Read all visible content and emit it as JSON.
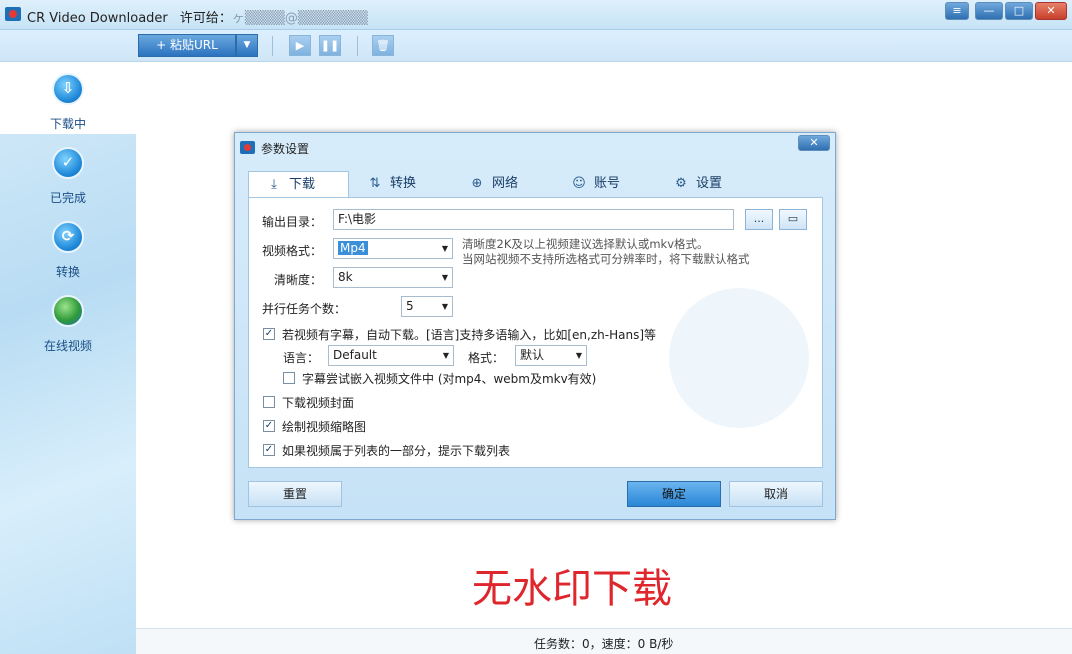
{
  "window": {
    "app_name": "CR Video Downloader",
    "license_label": "许可给：",
    "license_value": "ヶ▒▒▒▒@▒▒▒▒▒▒▒"
  },
  "toolbar": {
    "paste_url_label": "+ 粘贴URL",
    "dropdown_glyph": "▼",
    "start_glyph": "▶",
    "pause_glyph": "❚❚",
    "delete_glyph": "🗑"
  },
  "sidebar": {
    "items": [
      {
        "label": "下载中",
        "icon": "download-icon",
        "glyph": "⇩"
      },
      {
        "label": "已完成",
        "icon": "check-icon",
        "glyph": "✓"
      },
      {
        "label": "转换",
        "icon": "convert-icon",
        "glyph": "⟳"
      },
      {
        "label": "在线视频",
        "icon": "globe-icon",
        "glyph": ""
      }
    ]
  },
  "dialog": {
    "title": "参数设置",
    "close_glyph": "✕",
    "tabs": [
      {
        "label": "下载",
        "icon": "download-icon",
        "glyph": "⤓"
      },
      {
        "label": "转换",
        "icon": "convert-icon",
        "glyph": "⇅"
      },
      {
        "label": "网络",
        "icon": "globe-icon",
        "glyph": "⊕"
      },
      {
        "label": "账号",
        "icon": "user-icon",
        "glyph": "☺"
      },
      {
        "label": "设置",
        "icon": "gear-icon",
        "glyph": "⚙"
      }
    ],
    "output_dir": {
      "label": "输出目录：",
      "value": "F:\\电影",
      "browse_label": "...",
      "folder_glyph": "▭"
    },
    "video_format": {
      "label": "视频格式：",
      "value": "Mp4"
    },
    "format_hint": {
      "line1": "清晰度2K及以上视频建议选择默认或mkv格式。",
      "line2": "当网站视频不支持所选格式可分辨率时，将下载默认格式"
    },
    "resolution": {
      "label": "清晰度：",
      "value": "8k"
    },
    "concurrency": {
      "label": "并行任务个数：",
      "value": "5"
    },
    "subtitle_download": {
      "checked": true,
      "label": "若视频有字幕，自动下载。[语言]支持多语输入，比如[en,zh-Hans]等"
    },
    "language": {
      "label": "语言：",
      "value": "Default"
    },
    "subtitle_format": {
      "label": "格式：",
      "value": "默认"
    },
    "embed_subtitle": {
      "checked": false,
      "label": "字幕尝试嵌入视频文件中 (对mp4、webm及mkv有效)"
    },
    "download_cover": {
      "checked": false,
      "label": "下载视频封面"
    },
    "draw_thumbnail": {
      "checked": true,
      "label": "绘制视频缩略图"
    },
    "playlist_prompt": {
      "checked": true,
      "label": "如果视频属于列表的一部分，提示下载列表"
    },
    "reset_label": "重置",
    "ok_label": "确定",
    "cancel_label": "取消",
    "check_glyph": "✓",
    "arrow_glyph": "▼"
  },
  "watermark_text": "无水印下载",
  "status": {
    "text": "任务数：0，速度：0 B/秒"
  },
  "colors": {
    "accent": "#2a86d6",
    "watermark": "#e0262d",
    "sidebar_label": "#1a4e86"
  }
}
